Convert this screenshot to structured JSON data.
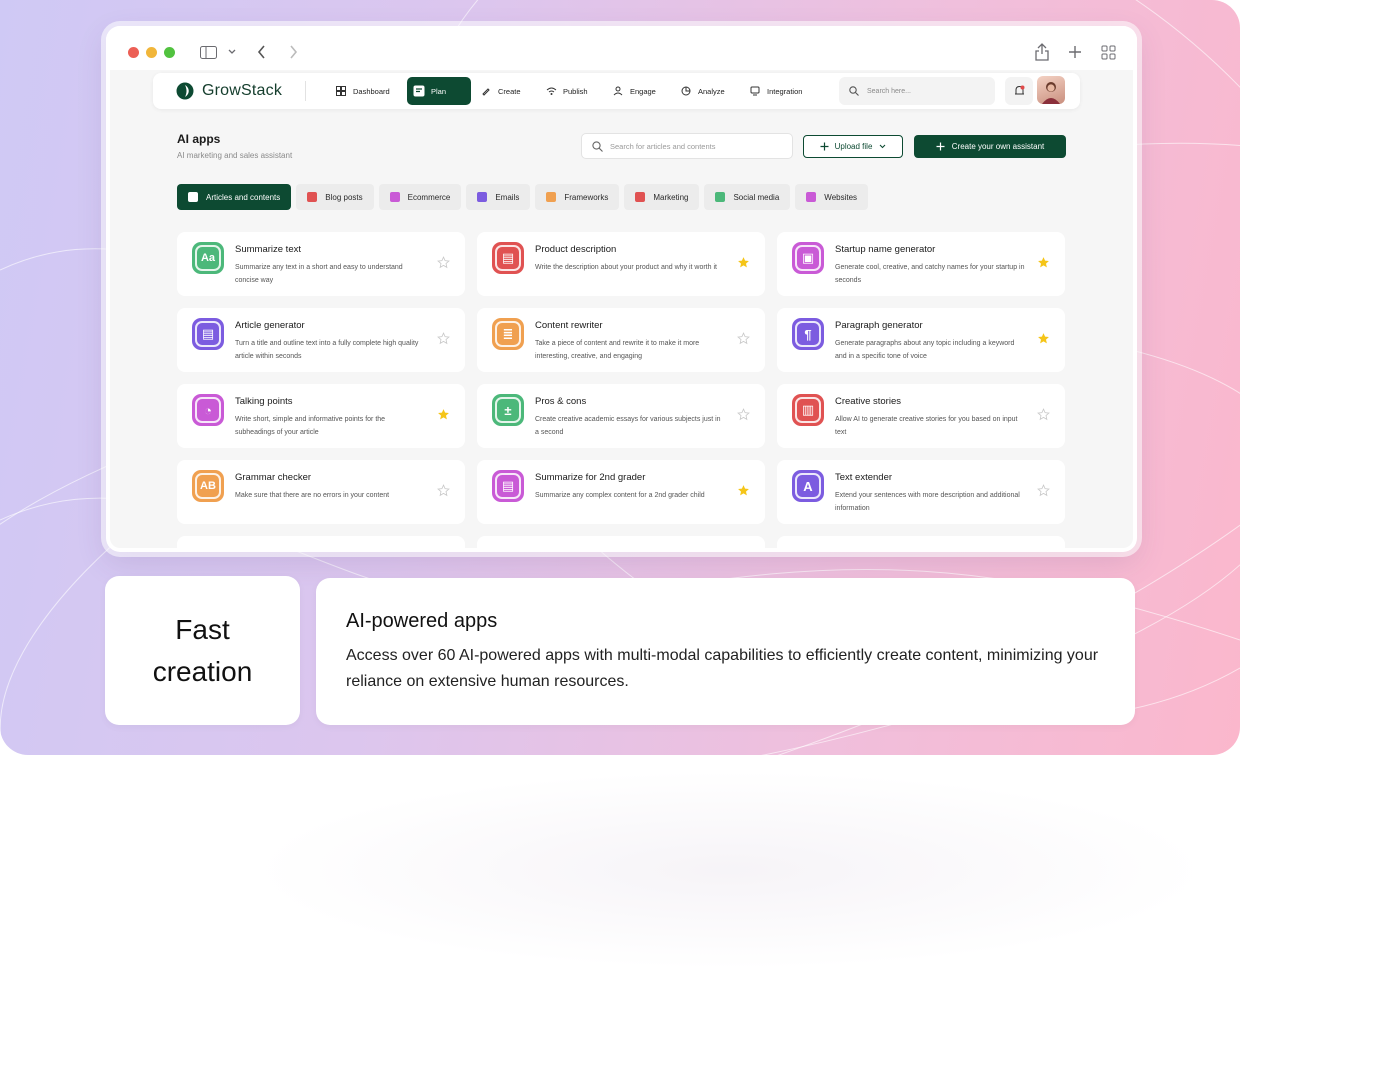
{
  "brand": {
    "name": "GrowStack",
    "accent": "#0d4a32"
  },
  "nav": {
    "items": [
      {
        "label": "Dashboard",
        "icon": "dashboard-icon"
      },
      {
        "label": "Plan",
        "icon": "plan-icon",
        "active": true
      },
      {
        "label": "Create",
        "icon": "pen-icon"
      },
      {
        "label": "Publish",
        "icon": "broadcast-icon"
      },
      {
        "label": "Engage",
        "icon": "users-icon"
      },
      {
        "label": "Analyze",
        "icon": "chart-pie-icon"
      },
      {
        "label": "Integration",
        "icon": "plug-icon"
      }
    ],
    "search_placeholder": "Search here..."
  },
  "page": {
    "title": "AI apps",
    "subtitle": "AI marketing and sales assistant",
    "search_placeholder": "Search for articles and contents",
    "upload_label": "Upload file",
    "create_label": "Create your own assistant"
  },
  "tabs": [
    {
      "label": "Articles and contents",
      "active": true,
      "color": "#ffffff"
    },
    {
      "label": "Blog posts",
      "color": "#e05252"
    },
    {
      "label": "Ecommerce",
      "color": "#c95ad6"
    },
    {
      "label": "Emails",
      "color": "#7c5ce0"
    },
    {
      "label": "Frameworks",
      "color": "#f0a050"
    },
    {
      "label": "Marketing",
      "color": "#e05252"
    },
    {
      "label": "Social media",
      "color": "#4cb87a"
    },
    {
      "label": "Websites",
      "color": "#c95ad6"
    }
  ],
  "cards": [
    {
      "title": "Summarize text",
      "desc": "Summarize any text in a short and easy to understand concise way",
      "color": "#4cb87a",
      "glyph": "Aa",
      "starred": false
    },
    {
      "title": "Product description",
      "desc": "Write the description about your product and why it worth it",
      "color": "#e05252",
      "glyph": "▤",
      "starred": true
    },
    {
      "title": "Startup name generator",
      "desc": "Generate cool, creative, and catchy names for your startup in seconds",
      "color": "#c95ad6",
      "glyph": "▣",
      "starred": true
    },
    {
      "title": "Article generator",
      "desc": "Turn a title and outline text into a fully complete high quality article within seconds",
      "color": "#7c5ce0",
      "glyph": "▤",
      "starred": false
    },
    {
      "title": "Content rewriter",
      "desc": "Take a piece of content and rewrite it to make it more interesting, creative, and engaging",
      "color": "#f0a050",
      "glyph": "≣",
      "starred": false
    },
    {
      "title": "Paragraph generator",
      "desc": "Generate paragraphs about any topic including a keyword and in a specific tone of voice",
      "color": "#7c5ce0",
      "glyph": "¶",
      "starred": true
    },
    {
      "title": "Talking points",
      "desc": "Write short, simple and informative points for the subheadings of your article",
      "color": "#c95ad6",
      "glyph": "◔",
      "starred": true
    },
    {
      "title": "Pros & cons",
      "desc": "Create creative academic essays for various subjects just in a second",
      "color": "#4cb87a",
      "glyph": "±",
      "starred": false
    },
    {
      "title": "Creative stories",
      "desc": "Allow AI to generate creative stories for you based on input text",
      "color": "#e05252",
      "glyph": "▥",
      "starred": false
    },
    {
      "title": "Grammar checker",
      "desc": "Make sure that there are no errors in your content",
      "color": "#f0a050",
      "glyph": "AB",
      "starred": false
    },
    {
      "title": "Summarize for 2nd grader",
      "desc": "Summarize any complex content for a 2nd grader child",
      "color": "#c95ad6",
      "glyph": "▤",
      "starred": true
    },
    {
      "title": "Text extender",
      "desc": "Extend your sentences with more description and additional information",
      "color": "#7c5ce0",
      "glyph": "A",
      "starred": false
    }
  ],
  "captions": {
    "left_line1": "Fast",
    "left_line2": "creation",
    "heading": "AI-powered apps",
    "body": "Access over 60 AI-powered apps with multi-modal capabilities to efficiently create content, minimizing your reliance on extensive human resources."
  },
  "colors": {
    "star": "#f5c518",
    "star_empty": "#c8c8c8"
  }
}
